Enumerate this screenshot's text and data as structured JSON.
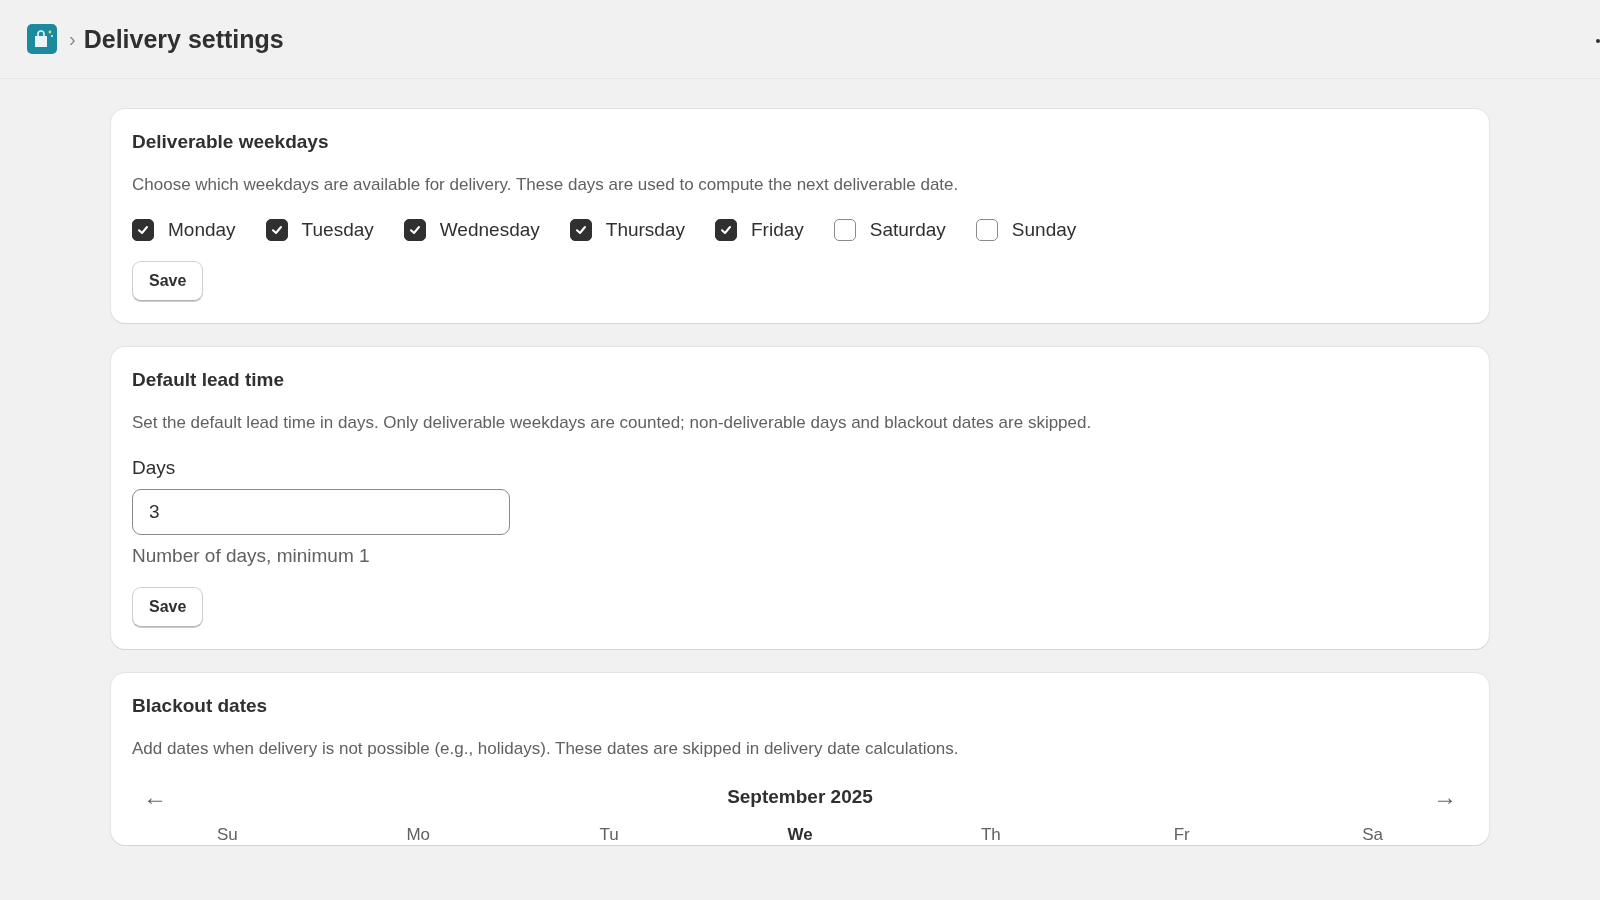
{
  "header": {
    "breadcrumb_separator": "›",
    "title": "Delivery settings"
  },
  "weekdays_card": {
    "title": "Deliverable weekdays",
    "description": "Choose which weekdays are available for delivery. These days are used to compute the next deliverable date.",
    "days": [
      {
        "label": "Monday",
        "checked": true
      },
      {
        "label": "Tuesday",
        "checked": true
      },
      {
        "label": "Wednesday",
        "checked": true
      },
      {
        "label": "Thursday",
        "checked": true
      },
      {
        "label": "Friday",
        "checked": true
      },
      {
        "label": "Saturday",
        "checked": false
      },
      {
        "label": "Sunday",
        "checked": false
      }
    ],
    "button": "Save"
  },
  "lead_time_card": {
    "title": "Default lead time",
    "description": "Set the default lead time in days. Only deliverable weekdays are counted; non-deliverable days and blackout dates are skipped.",
    "field_label": "Days",
    "value": "3",
    "help": "Number of days, minimum 1",
    "button": "Save"
  },
  "blackout_card": {
    "title": "Blackout dates",
    "description": "Add dates when delivery is not possible (e.g., holidays). These dates are skipped in delivery date calculations.",
    "calendar": {
      "prev": "←",
      "month": "September 2025",
      "next": "→",
      "weekdays": [
        {
          "label": "Su",
          "current": false
        },
        {
          "label": "Mo",
          "current": false
        },
        {
          "label": "Tu",
          "current": false
        },
        {
          "label": "We",
          "current": true
        },
        {
          "label": "Th",
          "current": false
        },
        {
          "label": "Fr",
          "current": false
        },
        {
          "label": "Sa",
          "current": false
        }
      ]
    }
  }
}
